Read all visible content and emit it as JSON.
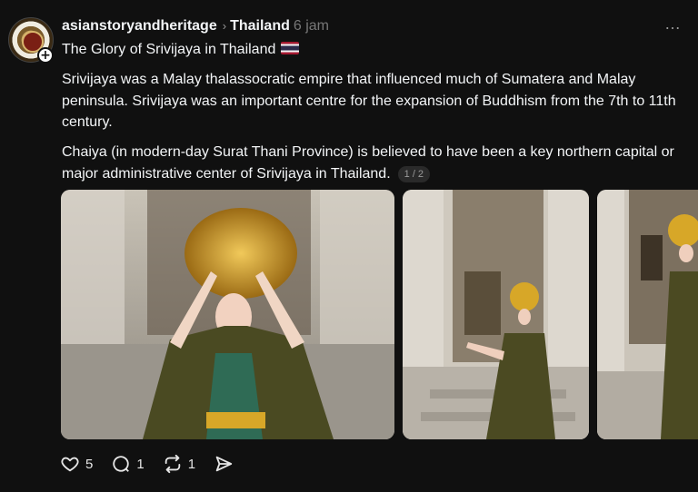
{
  "author": {
    "username": "asianstoryandheritage",
    "avatar_icon": "heritage-logo"
  },
  "post": {
    "topic": "Thailand",
    "time": "6 jam",
    "title": "The Glory of Srivijaya in Thailand",
    "flag_icon": "thailand-flag",
    "paragraphs": [
      "Srivijaya was a Malay thalassocratic empire that influenced much of Sumatera and Malay peninsula. Srivijaya was an important centre for the expansion of Buddhism from the 7th to 11th century.",
      "Chaiya (in modern-day Surat Thani Province) is believed to have been a key northern capital or major administrative center of Srivijaya in Thailand."
    ],
    "pager": "1 / 2"
  },
  "actions": {
    "likes": "5",
    "replies": "1",
    "reposts": "1"
  },
  "icons": {
    "more": "…",
    "follow": "+",
    "chevron": "›"
  },
  "colors": {
    "background": "#101010",
    "text": "#f3f5f7",
    "muted": "#777777"
  }
}
